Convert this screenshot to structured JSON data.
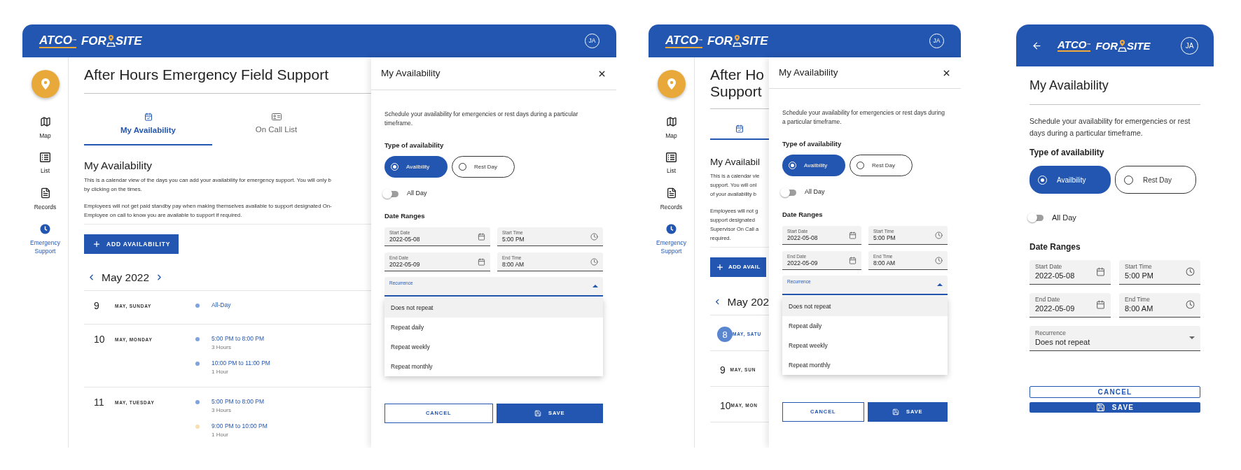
{
  "screens": [
    {
      "kind": "desktop",
      "header": {
        "brand": "ATCO$^{™}$",
        "product_left": "FOR",
        "product_right": "SITE",
        "avatar": "JA"
      },
      "sidebar": {
        "items": [
          {
            "kind": "map",
            "label": "Map",
            "selected": false
          },
          {
            "kind": "list",
            "label": "List",
            "selected": false
          },
          {
            "kind": "records",
            "label": "Records",
            "selected": false
          },
          {
            "kind": "emergency",
            "label": "Emergency Support",
            "selected": true
          }
        ]
      },
      "page": {
        "title_lines": [
          "After Hours Emergency Field Support"
        ],
        "tabs": [
          {
            "kind": "calendar",
            "label": "My Availability",
            "selected": true
          },
          {
            "kind": "card",
            "label": "On Call List",
            "selected": false
          }
        ],
        "heading": "My Availability",
        "paragraphs": [
          [
            "This is a calendar view of the days you can add your availability for emergency support. You will only b",
            "by clicking on the times."
          ],
          [
            "Employees will not get paid standby pay when making themselves available to support designated On-",
            "Employee on call to know you are available to support if required."
          ]
        ],
        "add_button": "ADD AVAILABILITY",
        "month": "May 2022",
        "days": [
          {
            "day": "9",
            "weekday": "MAY, SUNDAY",
            "selected": false,
            "events": [
              {
                "time": "All-Day",
                "color": "#7fa3dc"
              }
            ]
          },
          {
            "day": "10",
            "weekday": "MAY, MONDAY",
            "selected": false,
            "events": [
              {
                "time": "5:00 PM to 8:00 PM",
                "duration": "3 Hours",
                "color": "#7fa3dc"
              },
              {
                "time": "10:00 PM to 11:00 PM",
                "duration": "1 Hour",
                "color": "#7fa3dc"
              }
            ]
          },
          {
            "day": "11",
            "weekday": "MAY, TUESDAY",
            "selected": false,
            "events": [
              {
                "time": "5:00 PM to 8:00 PM",
                "duration": "3 Hours",
                "color": "#7fa3dc"
              },
              {
                "time": "9:00 PM to 10:00 PM",
                "duration": "1 Hour",
                "color": "#f7dfb0"
              }
            ]
          }
        ]
      },
      "dialog": {
        "title": "My Availability",
        "closable": true,
        "description": "Schedule your availability for emergencies or rest days during a particular timeframe.",
        "type_label": "Type of availability",
        "options": [
          {
            "label": "Availbility",
            "selected": true
          },
          {
            "label": "Rest Day",
            "selected": false
          }
        ],
        "all_day": {
          "label": "All Day",
          "on": false
        },
        "date_label": "Date Ranges",
        "fields": [
          {
            "kind": "date",
            "label": "Start Date",
            "value": "2022-05-08"
          },
          {
            "kind": "time",
            "label": "Start Time",
            "value": "5:00 PM"
          },
          {
            "kind": "date",
            "label": "End Date",
            "value": "2022-05-09"
          },
          {
            "kind": "time",
            "label": "End Time",
            "value": "8:00 AM"
          }
        ],
        "recurrence": {
          "label": "Recurrence",
          "expanded": true,
          "options": [
            {
              "label": "Does not repeat",
              "selected": true
            },
            {
              "label": "Repeat daily",
              "selected": false
            },
            {
              "label": "Repeat weekly",
              "selected": false
            },
            {
              "label": "Repeat monthly",
              "selected": false
            }
          ]
        },
        "cancel": "CANCEL",
        "save": "SAVE"
      }
    },
    {
      "kind": "tablet",
      "header": {
        "brand": "ATCO$^{™}$",
        "product_left": "FOR",
        "product_right": "SITE",
        "avatar": "JA"
      },
      "sidebar": {
        "items": [
          {
            "kind": "map",
            "label": "Map",
            "selected": false
          },
          {
            "kind": "list",
            "label": "List",
            "selected": false
          },
          {
            "kind": "records",
            "label": "Records",
            "selected": false
          },
          {
            "kind": "emergency",
            "label": "Emergency Support",
            "selected": true
          }
        ]
      },
      "page": {
        "title_lines": [
          "After Ho",
          "Support"
        ],
        "tabs": [
          {
            "kind": "calendar",
            "selected": true
          }
        ],
        "heading": "My Availabil",
        "paragraphs": [
          [
            "This is a calendar vie",
            "support. You will onl",
            "of your availability b"
          ],
          [
            "Employees will not g",
            "support designated",
            "Supervisor On Call a",
            "required."
          ]
        ],
        "add_button": "ADD AVAIL",
        "month": "May 202",
        "days": [
          {
            "day": "8",
            "weekday": "MAY, SATU",
            "selected": true
          },
          {
            "day": "9",
            "weekday": "MAY, SUN",
            "selected": false
          },
          {
            "day": "10",
            "weekday": "MAY, MON",
            "selected": false
          }
        ]
      },
      "dialog": {
        "title": "My Availability",
        "closable": true,
        "description": "Schedule your availability for emergencies or rest days during a particular timeframe.",
        "type_label": "Type of availability",
        "options": [
          {
            "label": "Availbility",
            "selected": true
          },
          {
            "label": "Rest Day",
            "selected": false
          }
        ],
        "all_day": {
          "label": "All Day",
          "on": false
        },
        "date_label": "Date Ranges",
        "fields": [
          {
            "kind": "date",
            "label": "Start Date",
            "value": "2022-05-08"
          },
          {
            "kind": "time",
            "label": "Start Time",
            "value": "5:00 PM"
          },
          {
            "kind": "date",
            "label": "End Date",
            "value": "2022-05-09"
          },
          {
            "kind": "time",
            "label": "End Time",
            "value": "8:00 AM"
          }
        ],
        "recurrence": {
          "label": "Recurrence",
          "expanded": true,
          "options": [
            {
              "label": "Does not repeat",
              "selected": true
            },
            {
              "label": "Repeat daily",
              "selected": false
            },
            {
              "label": "Repeat weekly",
              "selected": false
            },
            {
              "label": "Repeat monthly",
              "selected": false
            }
          ]
        },
        "cancel": "CANCEL",
        "save": "SAVE"
      }
    },
    {
      "kind": "mobile",
      "header": {
        "back": true,
        "brand": "ATCO$^{™}$",
        "product_left": "FOR",
        "product_right": "SITE",
        "avatar": "JA"
      },
      "dialog": {
        "title": "My Availability",
        "closable": false,
        "description": "Schedule your availability for emergencies or rest days during a particular timeframe.",
        "type_label": "Type of availability",
        "options": [
          {
            "label": "Availbility",
            "selected": true
          },
          {
            "label": "Rest Day",
            "selected": false
          }
        ],
        "all_day": {
          "label": "All Day",
          "on": false
        },
        "date_label": "Date Ranges",
        "fields": [
          {
            "kind": "date",
            "label": "Start Date",
            "value": "2022-05-08"
          },
          {
            "kind": "time",
            "label": "Start Time",
            "value": "5:00 PM"
          },
          {
            "kind": "date",
            "label": "End Date",
            "value": "2022-05-09"
          },
          {
            "kind": "time",
            "label": "End Time",
            "value": "8:00 AM"
          }
        ],
        "recurrence": {
          "label": "Recurrence",
          "value": "Does not repeat",
          "expanded": false
        },
        "cancel": "CANCEL",
        "save": "SAVE"
      }
    }
  ]
}
